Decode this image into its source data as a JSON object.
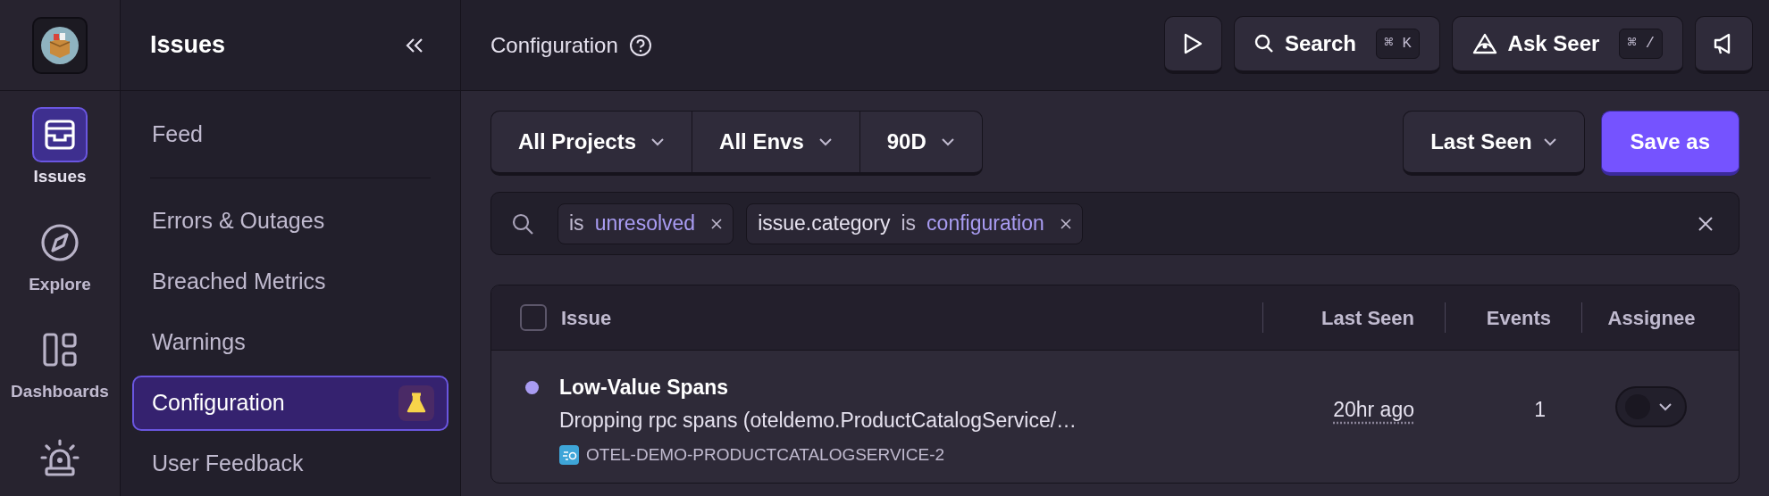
{
  "rail": {
    "items": [
      {
        "kind": "inbox",
        "label": "Issues",
        "selected": true
      },
      {
        "kind": "compass",
        "label": "Explore",
        "selected": false
      },
      {
        "kind": "dashboard",
        "label": "Dashboards",
        "selected": false
      },
      {
        "kind": "siren",
        "selected": false
      }
    ]
  },
  "nav": {
    "title": "Issues",
    "sections": [
      [
        {
          "label": "Feed",
          "selected": false,
          "experimental": false
        }
      ],
      [
        {
          "label": "Errors & Outages",
          "selected": false,
          "experimental": false
        },
        {
          "label": "Breached Metrics",
          "selected": false,
          "experimental": false
        },
        {
          "label": "Warnings",
          "selected": false,
          "experimental": false
        },
        {
          "label": "Configuration",
          "selected": true,
          "experimental": true
        },
        {
          "label": "User Feedback",
          "selected": false,
          "experimental": false
        }
      ]
    ]
  },
  "topbar": {
    "title": "Configuration",
    "buttons": [
      {
        "kind": "play"
      },
      {
        "kind": "search",
        "label": "Search",
        "shortcut": "⌘ K"
      },
      {
        "kind": "assistant",
        "label": "Ask Seer",
        "shortcut": "⌘ /"
      },
      {
        "kind": "megaphone"
      }
    ]
  },
  "filters": {
    "segments": [
      "All Projects",
      "All Envs",
      "90D"
    ],
    "sort": "Last Seen",
    "save": "Save as"
  },
  "search": {
    "tokens": [
      {
        "op": "is",
        "value": "unresolved"
      },
      {
        "key": "issue.category",
        "op": "is",
        "value": "configuration"
      }
    ]
  },
  "table": {
    "select_all": false,
    "columns": [
      "Issue",
      "Last Seen",
      "Events",
      "Assignee"
    ],
    "rows": [
      {
        "unread": true,
        "title": "Low-Value Spans",
        "message": "Dropping rpc spans (oteldemo.ProductCatalogService/…",
        "project": "OTEL-DEMO-PRODUCTCATALOGSERVICE-2",
        "last_seen": "20hr ago",
        "events": "1"
      }
    ]
  }
}
